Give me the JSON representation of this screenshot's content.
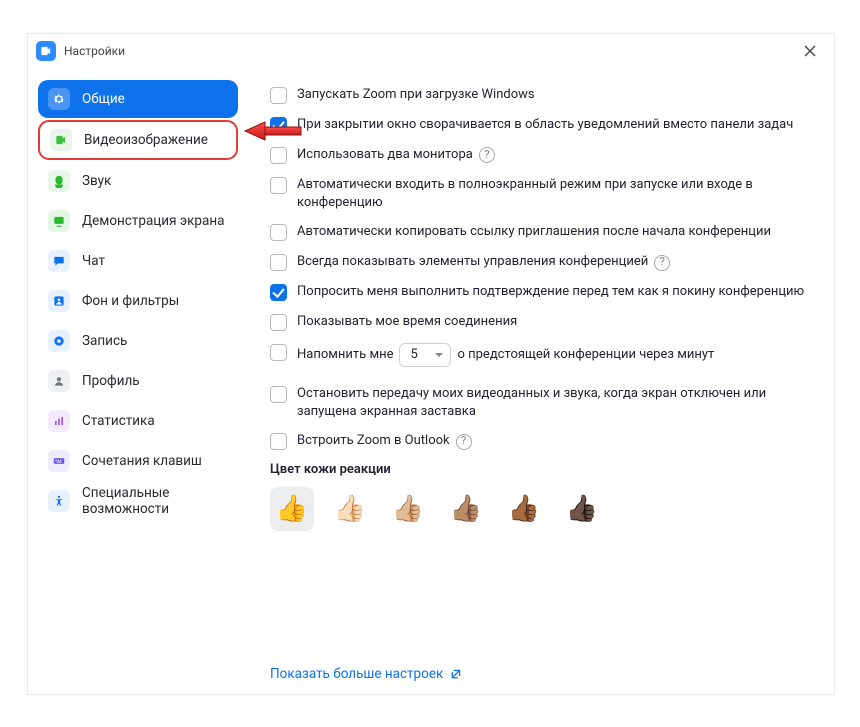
{
  "window": {
    "title": "Настройки"
  },
  "sidebar": {
    "items": [
      {
        "label": "Общие",
        "icon": "gear",
        "color": "#0e72ed",
        "fg": "#fff",
        "active": true
      },
      {
        "label": "Видеоизображение",
        "icon": "video",
        "color": "#e8f5e8",
        "fg": "#3cc13c",
        "highlighted": true
      },
      {
        "label": "Звук",
        "icon": "audio",
        "color": "#e8f7e8",
        "fg": "#2bb82b"
      },
      {
        "label": "Демонстрация экрана",
        "icon": "share",
        "color": "#e4f7e4",
        "fg": "#2bb82b"
      },
      {
        "label": "Чат",
        "icon": "chat",
        "color": "#e7f1ff",
        "fg": "#0e72ed"
      },
      {
        "label": "Фон и фильтры",
        "icon": "bg",
        "color": "#e7f1ff",
        "fg": "#0e72ed"
      },
      {
        "label": "Запись",
        "icon": "record",
        "color": "#e7f1ff",
        "fg": "#0e72ed"
      },
      {
        "label": "Профиль",
        "icon": "profile",
        "color": "#eef0f2",
        "fg": "#6f7580"
      },
      {
        "label": "Статистика",
        "icon": "stats",
        "color": "#f4eaff",
        "fg": "#a05be0"
      },
      {
        "label": "Сочетания клавиш",
        "icon": "keyboard",
        "color": "#eeeaff",
        "fg": "#6a5ae8"
      },
      {
        "label": "Специальные",
        "label2": "возможности",
        "icon": "access",
        "color": "#e7f1ff",
        "fg": "#0e72ed"
      }
    ]
  },
  "options": [
    {
      "checked": false,
      "text": "Запускать Zoom при загрузке Windows"
    },
    {
      "checked": true,
      "text": "При закрытии окно сворачивается в область уведомлений вместо панели задач"
    },
    {
      "checked": false,
      "text": "Использовать два монитора",
      "help": true
    },
    {
      "checked": false,
      "text": "Автоматически входить в полноэкранный режим при запуске или входе в конференцию"
    },
    {
      "checked": false,
      "text": "Автоматически копировать ссылку приглашения после начала конференции"
    },
    {
      "checked": false,
      "text": "Всегда показывать элементы управления конференцией",
      "help": true
    },
    {
      "checked": true,
      "text": "Попросить меня выполнить подтверждение перед тем как я покину конференцию"
    },
    {
      "checked": false,
      "text": "Показывать мое время соединения"
    },
    {
      "checked": false,
      "remind_prefix": "Напомнить мне",
      "remind_value": "5",
      "remind_suffix": "о предстоящей конференции через минут"
    },
    {
      "checked": false,
      "text": "Остановить передачу моих видеоданных и звука, когда экран отключен или запущена экранная заставка",
      "gap_before": true
    },
    {
      "checked": false,
      "text": "Встроить Zoom в Outlook",
      "help": true
    }
  ],
  "skin": {
    "label": "Цвет кожи реакции",
    "tones": [
      "👍",
      "👍🏻",
      "👍🏼",
      "👍🏽",
      "👍🏾",
      "👍🏿"
    ],
    "selected": 0
  },
  "more_link": "Показать больше настроек"
}
